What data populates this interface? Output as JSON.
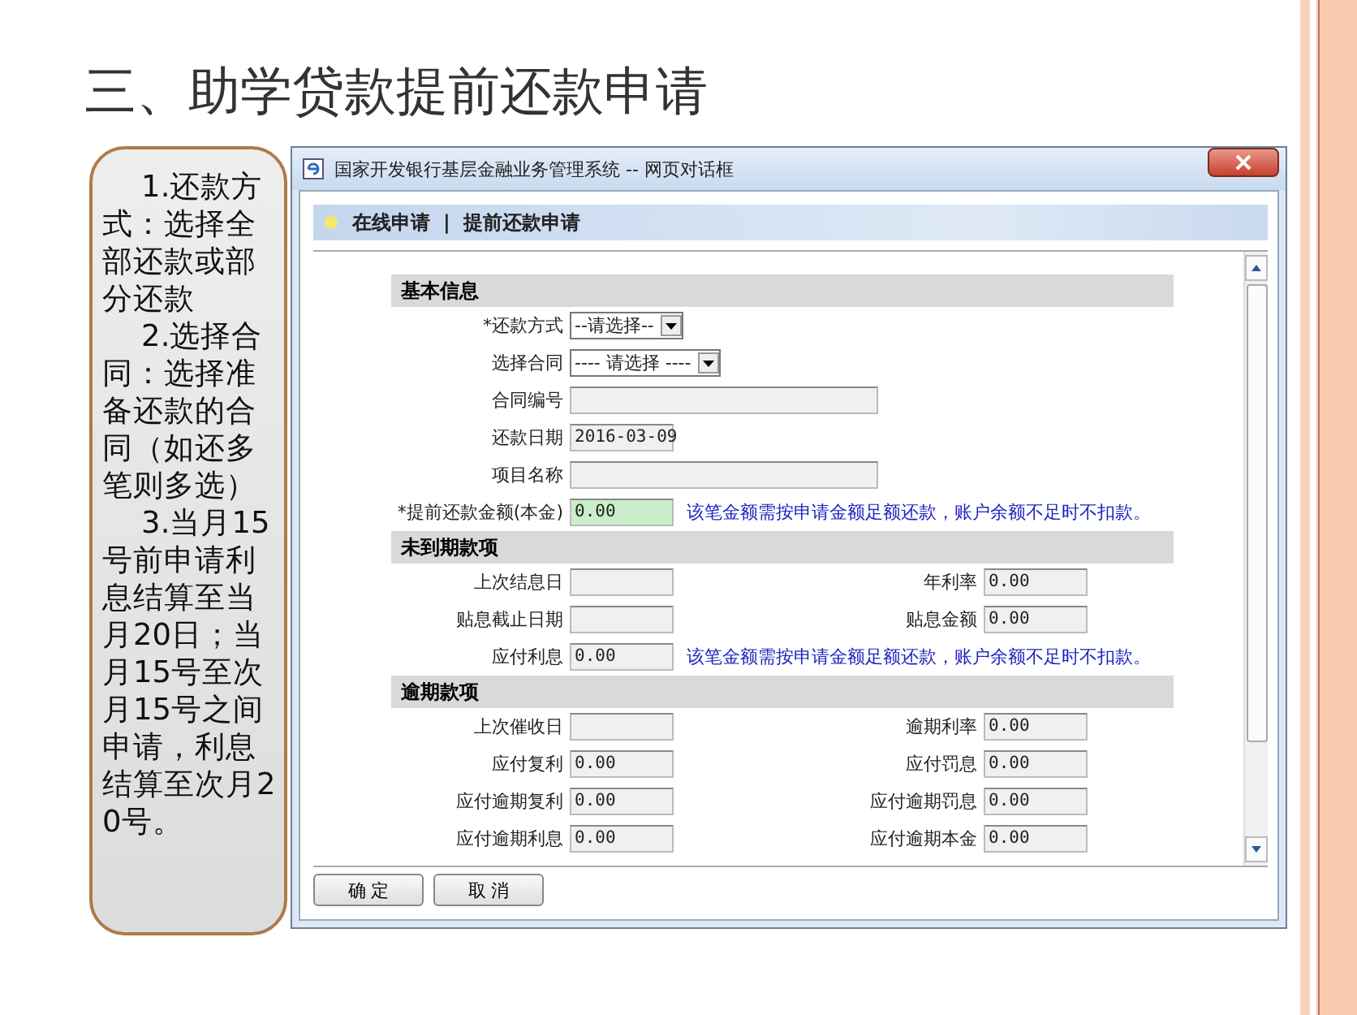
{
  "slide": {
    "title": "三、助学贷款提前还款申请",
    "notes": [
      "1.还款方式：选择全部还款或部分还款",
      "2.选择合同：选择准备还款的合同（如还多笔则多选）",
      "3.当月15号前申请利息结算至当月20日；当月15号至次月15号之间申请，利息结算至次月20号。"
    ]
  },
  "dialog": {
    "title": "国家开发银行基层金融业务管理系统 -- 网页对话框",
    "breadcrumb": {
      "parent": "在线申请",
      "separator": "|",
      "current": "提前还款申请"
    },
    "sections": [
      {
        "title": "基本信息",
        "rows": [
          {
            "label": "*还款方式",
            "field": {
              "kind": "select",
              "value": "--请选择--",
              "editable": true
            }
          },
          {
            "label": "选择合同",
            "field": {
              "kind": "select",
              "value": "---- 请选择 ----",
              "editable": true
            }
          },
          {
            "label": "合同编号",
            "field": {
              "kind": "long-input",
              "editable": false
            }
          },
          {
            "label": "还款日期",
            "field": {
              "kind": "short-input",
              "value": "2016-03-09",
              "editable": false
            }
          },
          {
            "label": "项目名称",
            "field": {
              "kind": "long-input",
              "editable": false
            }
          },
          {
            "label": "*提前还款金额(本金)",
            "field": {
              "kind": "short-input",
              "value": "0.00",
              "editable": true
            },
            "note": "该笔金额需按申请金额足额还款，账户余额不足时不扣款。"
          }
        ]
      },
      {
        "title": "未到期款项",
        "rows": [
          {
            "label": "上次结息日",
            "field": {
              "kind": "short-input",
              "editable": false
            },
            "right_label": "年利率",
            "right_field": {
              "kind": "short-input",
              "value": "0.00",
              "editable": false
            }
          },
          {
            "label": "贴息截止日期",
            "field": {
              "kind": "short-input",
              "editable": false
            },
            "right_label": "贴息金额",
            "right_field": {
              "kind": "short-input",
              "value": "0.00",
              "editable": false
            }
          },
          {
            "label": "应付利息",
            "field": {
              "kind": "short-input",
              "value": "0.00",
              "editable": false
            },
            "note": "该笔金额需按申请金额足额还款，账户余额不足时不扣款。"
          }
        ]
      },
      {
        "title": "逾期款项",
        "rows": [
          {
            "label": "上次催收日",
            "field": {
              "kind": "short-input",
              "editable": false
            },
            "right_label": "逾期利率",
            "right_field": {
              "kind": "short-input",
              "value": "0.00",
              "editable": false
            }
          },
          {
            "label": "应付复利",
            "field": {
              "kind": "short-input",
              "value": "0.00",
              "editable": false
            },
            "right_label": "应付罚息",
            "right_field": {
              "kind": "short-input",
              "value": "0.00",
              "editable": false
            }
          },
          {
            "label": "应付逾期复利",
            "field": {
              "kind": "short-input",
              "value": "0.00",
              "editable": false
            },
            "right_label": "应付逾期罚息",
            "right_field": {
              "kind": "short-input",
              "value": "0.00",
              "editable": false
            }
          },
          {
            "label": "应付逾期利息",
            "field": {
              "kind": "short-input",
              "value": "0.00",
              "editable": false
            },
            "right_label": "应付逾期本金",
            "right_field": {
              "kind": "short-input",
              "value": "0.00",
              "editable": false
            }
          }
        ]
      }
    ],
    "buttons": [
      "确 定",
      "取 消"
    ]
  }
}
